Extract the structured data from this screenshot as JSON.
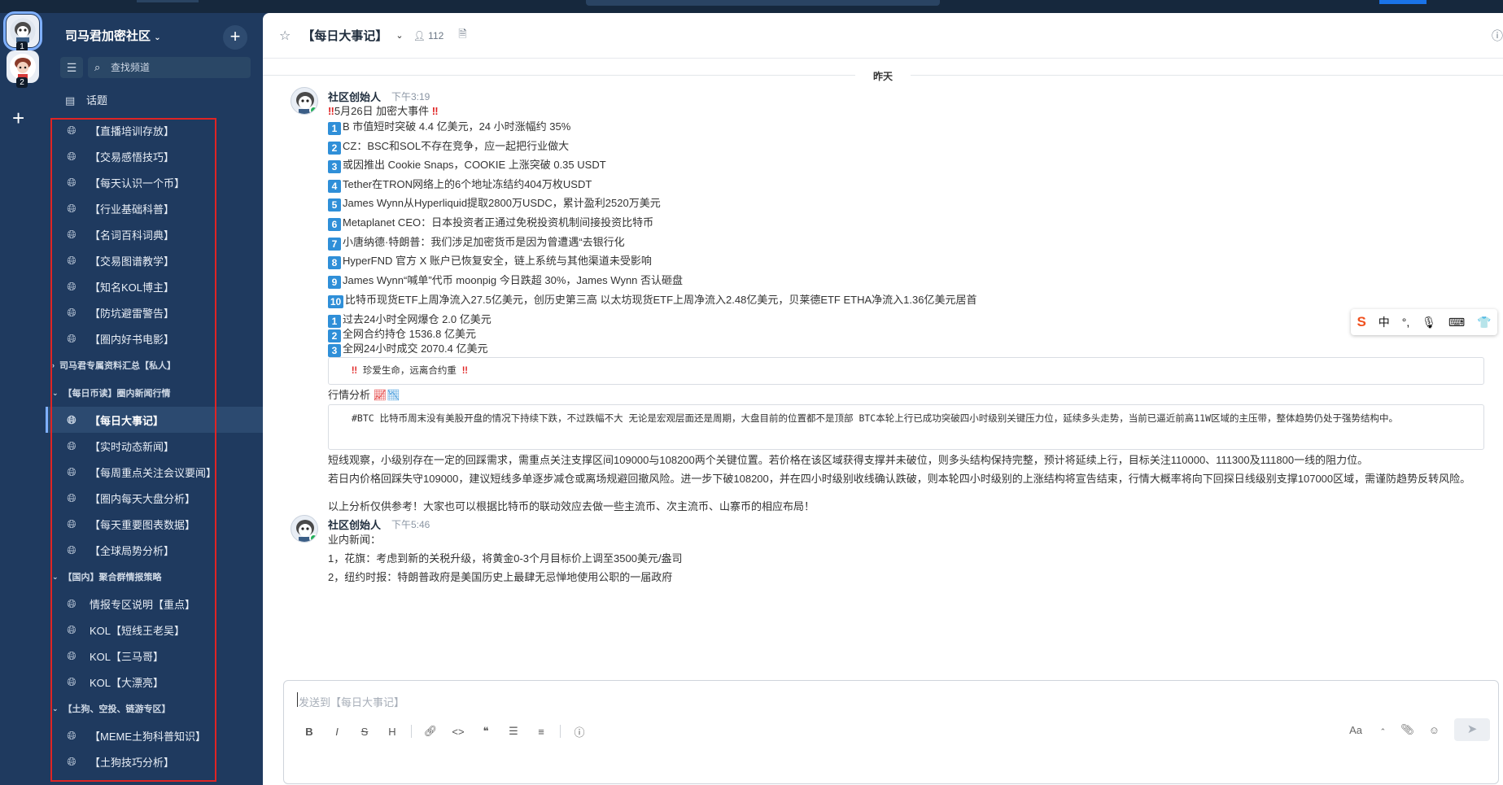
{
  "server_rail": {
    "servers": [
      {
        "badge": "1"
      },
      {
        "badge": "2"
      }
    ],
    "add_icon": "+"
  },
  "sidebar": {
    "server_name": "司马君加密社区",
    "add_icon": "+",
    "search_placeholder": "查找频道",
    "topics_label": "话题",
    "items": [
      {
        "type": "channel",
        "label": "【直播培训存放】"
      },
      {
        "type": "channel",
        "label": "【交易感悟技巧】"
      },
      {
        "type": "channel",
        "label": "【每天认识一个币】"
      },
      {
        "type": "channel",
        "label": "【行业基础科普】"
      },
      {
        "type": "channel",
        "label": "【名词百科词典】"
      },
      {
        "type": "channel",
        "label": "【交易图谱教学】"
      },
      {
        "type": "channel",
        "label": "【知名KOL博主】"
      },
      {
        "type": "channel",
        "label": "【防坑避雷警告】"
      },
      {
        "type": "channel",
        "label": "【圈内好书电影】"
      },
      {
        "type": "category",
        "label": "司马君专属资料汇总【私人】",
        "collapsed": true
      },
      {
        "type": "category",
        "label": "【每日币读】圈内新闻行情",
        "collapsed": false
      },
      {
        "type": "channel",
        "label": "【每日大事记】",
        "active": true
      },
      {
        "type": "channel",
        "label": "【实时动态新闻】"
      },
      {
        "type": "channel",
        "label": "【每周重点关注会议要闻】"
      },
      {
        "type": "channel",
        "label": "【圈内每天大盘分析】"
      },
      {
        "type": "channel",
        "label": "【每天重要图表数据】"
      },
      {
        "type": "channel",
        "label": "【全球局势分析】"
      },
      {
        "type": "category",
        "label": "【国内】聚合群情报策略",
        "collapsed": false
      },
      {
        "type": "channel",
        "label": "情报专区说明【重点】"
      },
      {
        "type": "channel",
        "label": "KOL【短线王老吴】"
      },
      {
        "type": "channel",
        "label": "KOL【三马哥】"
      },
      {
        "type": "channel",
        "label": "KOL【大漂亮】"
      },
      {
        "type": "category",
        "label": "【土狗、空投、链游专区】",
        "collapsed": false
      },
      {
        "type": "channel",
        "label": "【MEME土狗科普知识】"
      },
      {
        "type": "channel",
        "label": "【土狗技巧分析】"
      }
    ]
  },
  "channel_header": {
    "title": "【每日大事记】",
    "member_count": "112"
  },
  "day_divider": "昨天",
  "messages": [
    {
      "author": "社区创始人",
      "time": "下午3:19",
      "headline": "5月26日  加密大事件",
      "items": [
        {
          "n": "1",
          "text": "B 市值短时突破 4.4 亿美元，24 小时涨幅约 35%"
        },
        {
          "n": "2",
          "text": "CZ：BSC和SOL不存在竞争，应一起把行业做大"
        },
        {
          "n": "3",
          "text": "或因推出 Cookie Snaps，COOKIE 上涨突破 0.35 USDT"
        },
        {
          "n": "4",
          "text": "Tether在TRON网络上的6个地址冻结约404万枚USDT"
        },
        {
          "n": "5",
          "text": "James Wynn从Hyperliquid提取2800万USDC，累计盈利2520万美元"
        },
        {
          "n": "6",
          "text": "Metaplanet CEO：日本投资者正通过免税投资机制间接投资比特币"
        },
        {
          "n": "7",
          "text": "小唐纳德·特朗普：我们涉足加密货币是因为曾遭遇“去银行化"
        },
        {
          "n": "8",
          "text": "HyperFND 官方 X 账户已恢复安全，链上系统与其他渠道未受影响"
        },
        {
          "n": "9",
          "text": "James Wynn“喊单”代币 moonpig 今日跌超 30%，James Wynn 否认砸盘"
        },
        {
          "n": "10",
          "text": "比特币现货ETF上周净流入27.5亿美元，创历史第三高 以太坊现货ETF上周净流入2.48亿美元，贝莱德ETF ETHA净流入1.36亿美元居首"
        }
      ],
      "stats": [
        {
          "n": "1",
          "text": "过去24小时全网爆仓 2.0 亿美元"
        },
        {
          "n": "2",
          "text": "全网合约持仓 1536.8  亿美元"
        },
        {
          "n": "3",
          "text": "全网24小时成交 2070.4  亿美元"
        }
      ],
      "warning": "珍爱生命，远离合约重",
      "analysis_label": "行情分析",
      "analysis_quote": "#BTC 比特币周末没有美股开盘的情况下持续下跌，不过跌幅不大 无论是宏观层面还是周期，大盘目前的位置都不是顶部 BTC本轮上行已成功突破四小时级别关键压力位，延续多头走势，当前已逼近前高11W区域的主压带，整体趋势仍处于强势结构中。",
      "para1": "短线观察，小级别存在一定的回踩需求，需重点关注支撑区间109000与108200两个关键位置。若价格在该区域获得支撑并未破位，则多头结构保持完整，预计将延续上行，目标关注110000、111300及111800一线的阻力位。",
      "para2": "若日内价格回踩失守109000，建议短线多单逐步减仓或离场规避回撤风险。进一步下破108200，并在四小时级别收线确认跌破，则本轮四小时级别的上涨结构将宣告结束，行情大概率将向下回探日线级别支撑107000区域，需谨防趋势反转风险。",
      "para3": "以上分析仅供参考！大家也可以根据比特币的联动效应去做一些主流币、次主流币、山寨币的相应布局！"
    },
    {
      "author": "社区创始人",
      "time": "下午5:46",
      "lines": [
        "业内新闻：",
        "1，花旗：考虑到新的关税升级，将黄金0-3个月目标价上调至3500美元/盎司",
        "2，纽约时报：特朗普政府是美国历史上最肆无忌惮地使用公职的一届政府"
      ]
    }
  ],
  "ime_toolbar": {
    "items": [
      "S",
      "中",
      "°,",
      "🎙",
      "⌨",
      "👕"
    ]
  },
  "composer": {
    "placeholder": "发送到【每日大事记】",
    "font_label": "Aa"
  },
  "colors": {
    "sidebar_bg": "#1f3a5f",
    "active_channel_bg": "#2c4a70",
    "highlight_box": "#e02424",
    "number_badge": "#2f8fd8",
    "online_dot": "#22b05a"
  }
}
